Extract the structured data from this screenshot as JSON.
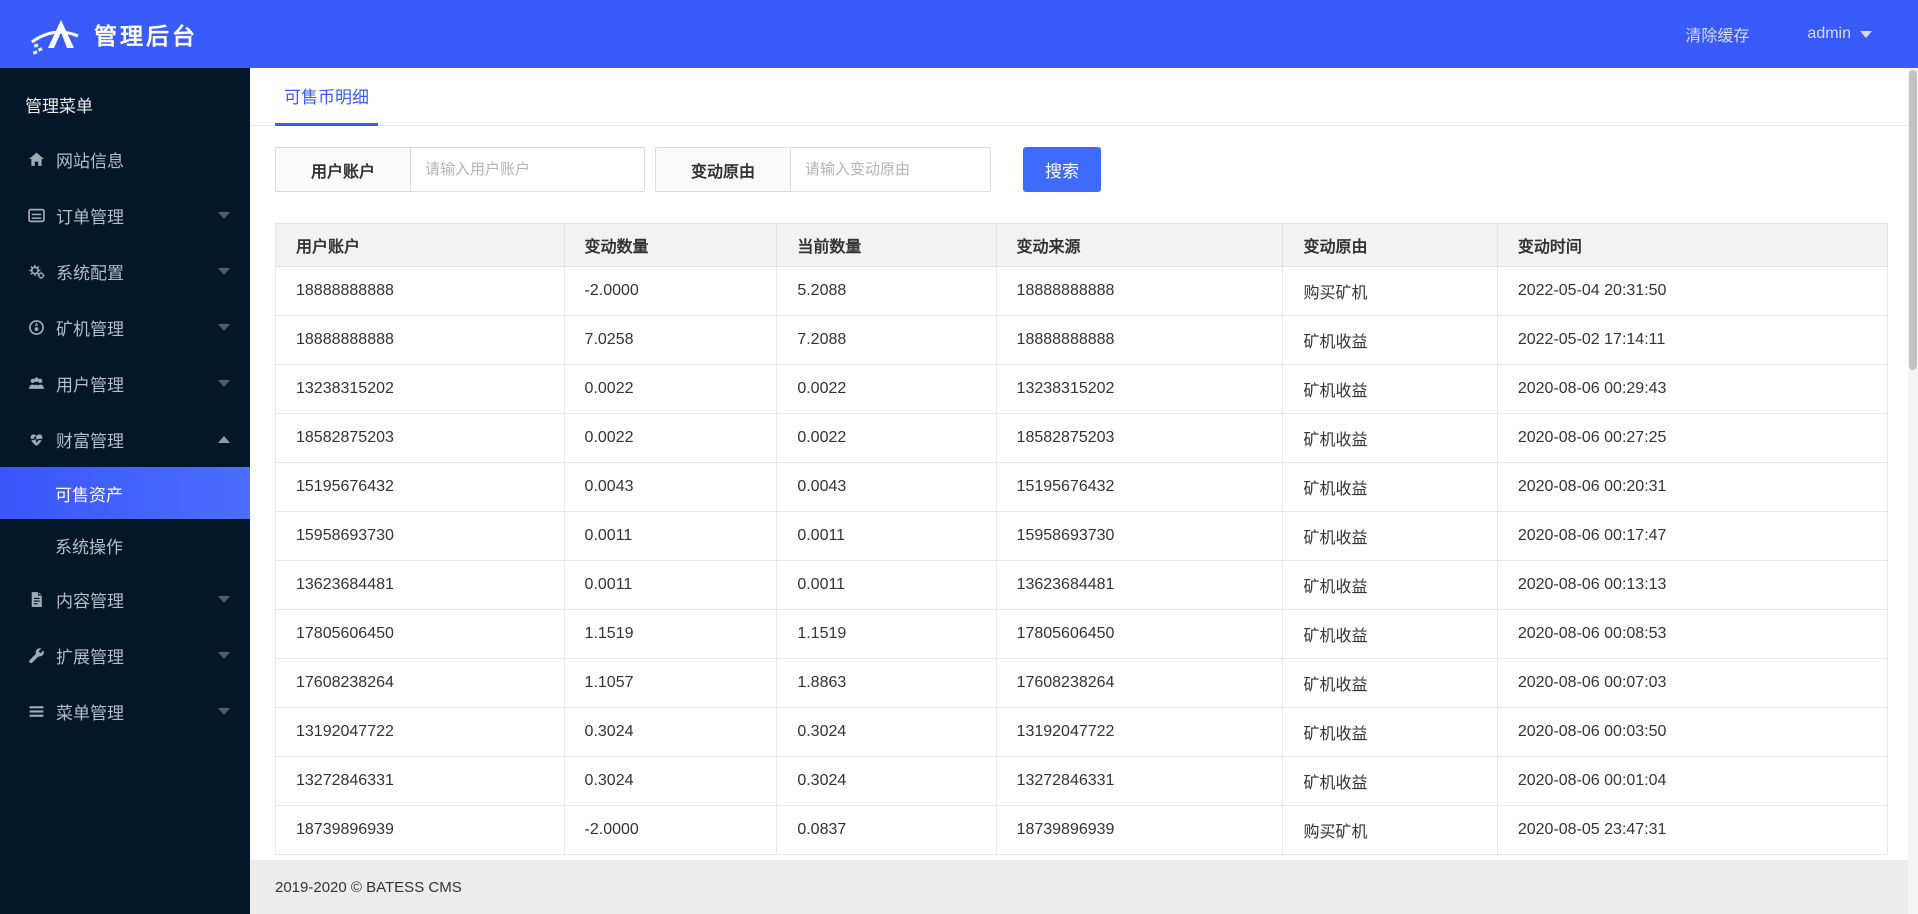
{
  "header": {
    "title": "管理后台",
    "clear_cache_label": "清除缓存",
    "username": "admin",
    "brand_color": "#3a5bfc"
  },
  "sidebar": {
    "menu_title": "管理菜单",
    "items": [
      {
        "label": "网站信息",
        "icon": "home",
        "caret": null,
        "type": "item",
        "active": false
      },
      {
        "label": "订单管理",
        "icon": "list",
        "caret": "down",
        "type": "item",
        "active": false
      },
      {
        "label": "系统配置",
        "icon": "cogs",
        "caret": "down",
        "type": "item",
        "active": false
      },
      {
        "label": "矿机管理",
        "icon": "miner",
        "caret": "down",
        "type": "item",
        "active": false
      },
      {
        "label": "用户管理",
        "icon": "users",
        "caret": "down",
        "type": "item",
        "active": false
      },
      {
        "label": "财富管理",
        "icon": "heartbeat",
        "caret": "up",
        "type": "item",
        "active": false
      },
      {
        "label": "可售资产",
        "icon": null,
        "caret": null,
        "type": "subitem",
        "active": true
      },
      {
        "label": "系统操作",
        "icon": null,
        "caret": null,
        "type": "subitem",
        "active": false
      },
      {
        "label": "内容管理",
        "icon": "file",
        "caret": "down",
        "type": "item",
        "active": false
      },
      {
        "label": "扩展管理",
        "icon": "wrench",
        "caret": "down",
        "type": "item",
        "active": false
      },
      {
        "label": "菜单管理",
        "icon": "bars",
        "caret": "down",
        "type": "item",
        "active": false
      }
    ]
  },
  "tabs": {
    "active_label": "可售币明细"
  },
  "search_form": {
    "fields": [
      {
        "label": "用户账户",
        "placeholder": "请输入用户账户",
        "value": ""
      },
      {
        "label": "变动原由",
        "placeholder": "请输入变动原由",
        "value": ""
      }
    ],
    "submit_label": "搜索"
  },
  "table": {
    "columns": [
      "用户账户",
      "变动数量",
      "当前数量",
      "变动来源",
      "变动原由",
      "变动时间"
    ],
    "col_widths": [
      "17.9%",
      "13.2%",
      "13.6%",
      "17.8%",
      "13.3%",
      "24.2%"
    ],
    "rows": [
      [
        "18888888888",
        "-2.0000",
        "5.2088",
        "18888888888",
        "购买矿机",
        "2022-05-04 20:31:50"
      ],
      [
        "18888888888",
        "7.0258",
        "7.2088",
        "18888888888",
        "矿机收益",
        "2022-05-02 17:14:11"
      ],
      [
        "13238315202",
        "0.0022",
        "0.0022",
        "13238315202",
        "矿机收益",
        "2020-08-06 00:29:43"
      ],
      [
        "18582875203",
        "0.0022",
        "0.0022",
        "18582875203",
        "矿机收益",
        "2020-08-06 00:27:25"
      ],
      [
        "15195676432",
        "0.0043",
        "0.0043",
        "15195676432",
        "矿机收益",
        "2020-08-06 00:20:31"
      ],
      [
        "15958693730",
        "0.0011",
        "0.0011",
        "15958693730",
        "矿机收益",
        "2020-08-06 00:17:47"
      ],
      [
        "13623684481",
        "0.0011",
        "0.0011",
        "13623684481",
        "矿机收益",
        "2020-08-06 00:13:13"
      ],
      [
        "17805606450",
        "1.1519",
        "1.1519",
        "17805606450",
        "矿机收益",
        "2020-08-06 00:08:53"
      ],
      [
        "17608238264",
        "1.1057",
        "1.8863",
        "17608238264",
        "矿机收益",
        "2020-08-06 00:07:03"
      ],
      [
        "13192047722",
        "0.3024",
        "0.3024",
        "13192047722",
        "矿机收益",
        "2020-08-06 00:03:50"
      ],
      [
        "13272846331",
        "0.3024",
        "0.3024",
        "13272846331",
        "矿机收益",
        "2020-08-06 00:01:04"
      ],
      [
        "18739896939",
        "-2.0000",
        "0.0837",
        "18739896939",
        "购买矿机",
        "2020-08-05 23:47:31"
      ]
    ]
  },
  "footer": {
    "copyright": "2019-2020 © BATESS CMS"
  }
}
